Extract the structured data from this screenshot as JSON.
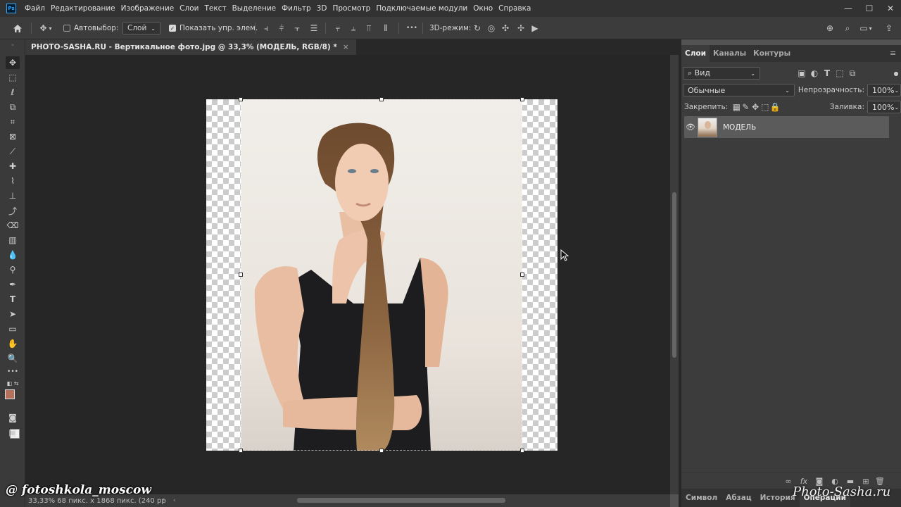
{
  "app": {
    "logo": "Ps"
  },
  "menu": [
    "Файл",
    "Редактирование",
    "Изображение",
    "Слои",
    "Текст",
    "Выделение",
    "Фильтр",
    "3D",
    "Просмотр",
    "Подключаемые модули",
    "Окно",
    "Справка"
  ],
  "window_controls": {
    "minimize": "—",
    "maximize": "☐",
    "close": "✕"
  },
  "options": {
    "autoselect_label": "Автовыбор:",
    "autoselect_value": "Слой",
    "show_controls_label": "Показать упр. элем.",
    "mode3d_label": "3D-режим:",
    "more": "•••"
  },
  "document": {
    "tab_title": "PHOTO-SASHA.RU - Вертикальное фото.jpg @ 33,3% (МОДЕЛЬ, RGB/8) *",
    "close": "×"
  },
  "status": {
    "text": "33,33%  68 пикс. x 1868 пикс. (240 pp"
  },
  "panels": {
    "tabs": [
      "Слои",
      "Каналы",
      "Контуры"
    ],
    "filter_label": "Вид",
    "blend_mode": "Обычные",
    "opacity_label": "Непрозрачность:",
    "opacity_value": "100%",
    "lock_label": "Закрепить:",
    "fill_label": "Заливка:",
    "fill_value": "100%",
    "layer_name": "МОДЕЛЬ",
    "bottom_tabs": [
      "Символ",
      "Абзац",
      "История",
      "Операции"
    ]
  },
  "watermarks": {
    "left": "@ fotoshkola_moscow",
    "right": "Photo-Sasha.ru"
  },
  "colors": {
    "foreground": "#b3705a",
    "background": "#f0f0f0",
    "accent": "#31a8ff"
  }
}
